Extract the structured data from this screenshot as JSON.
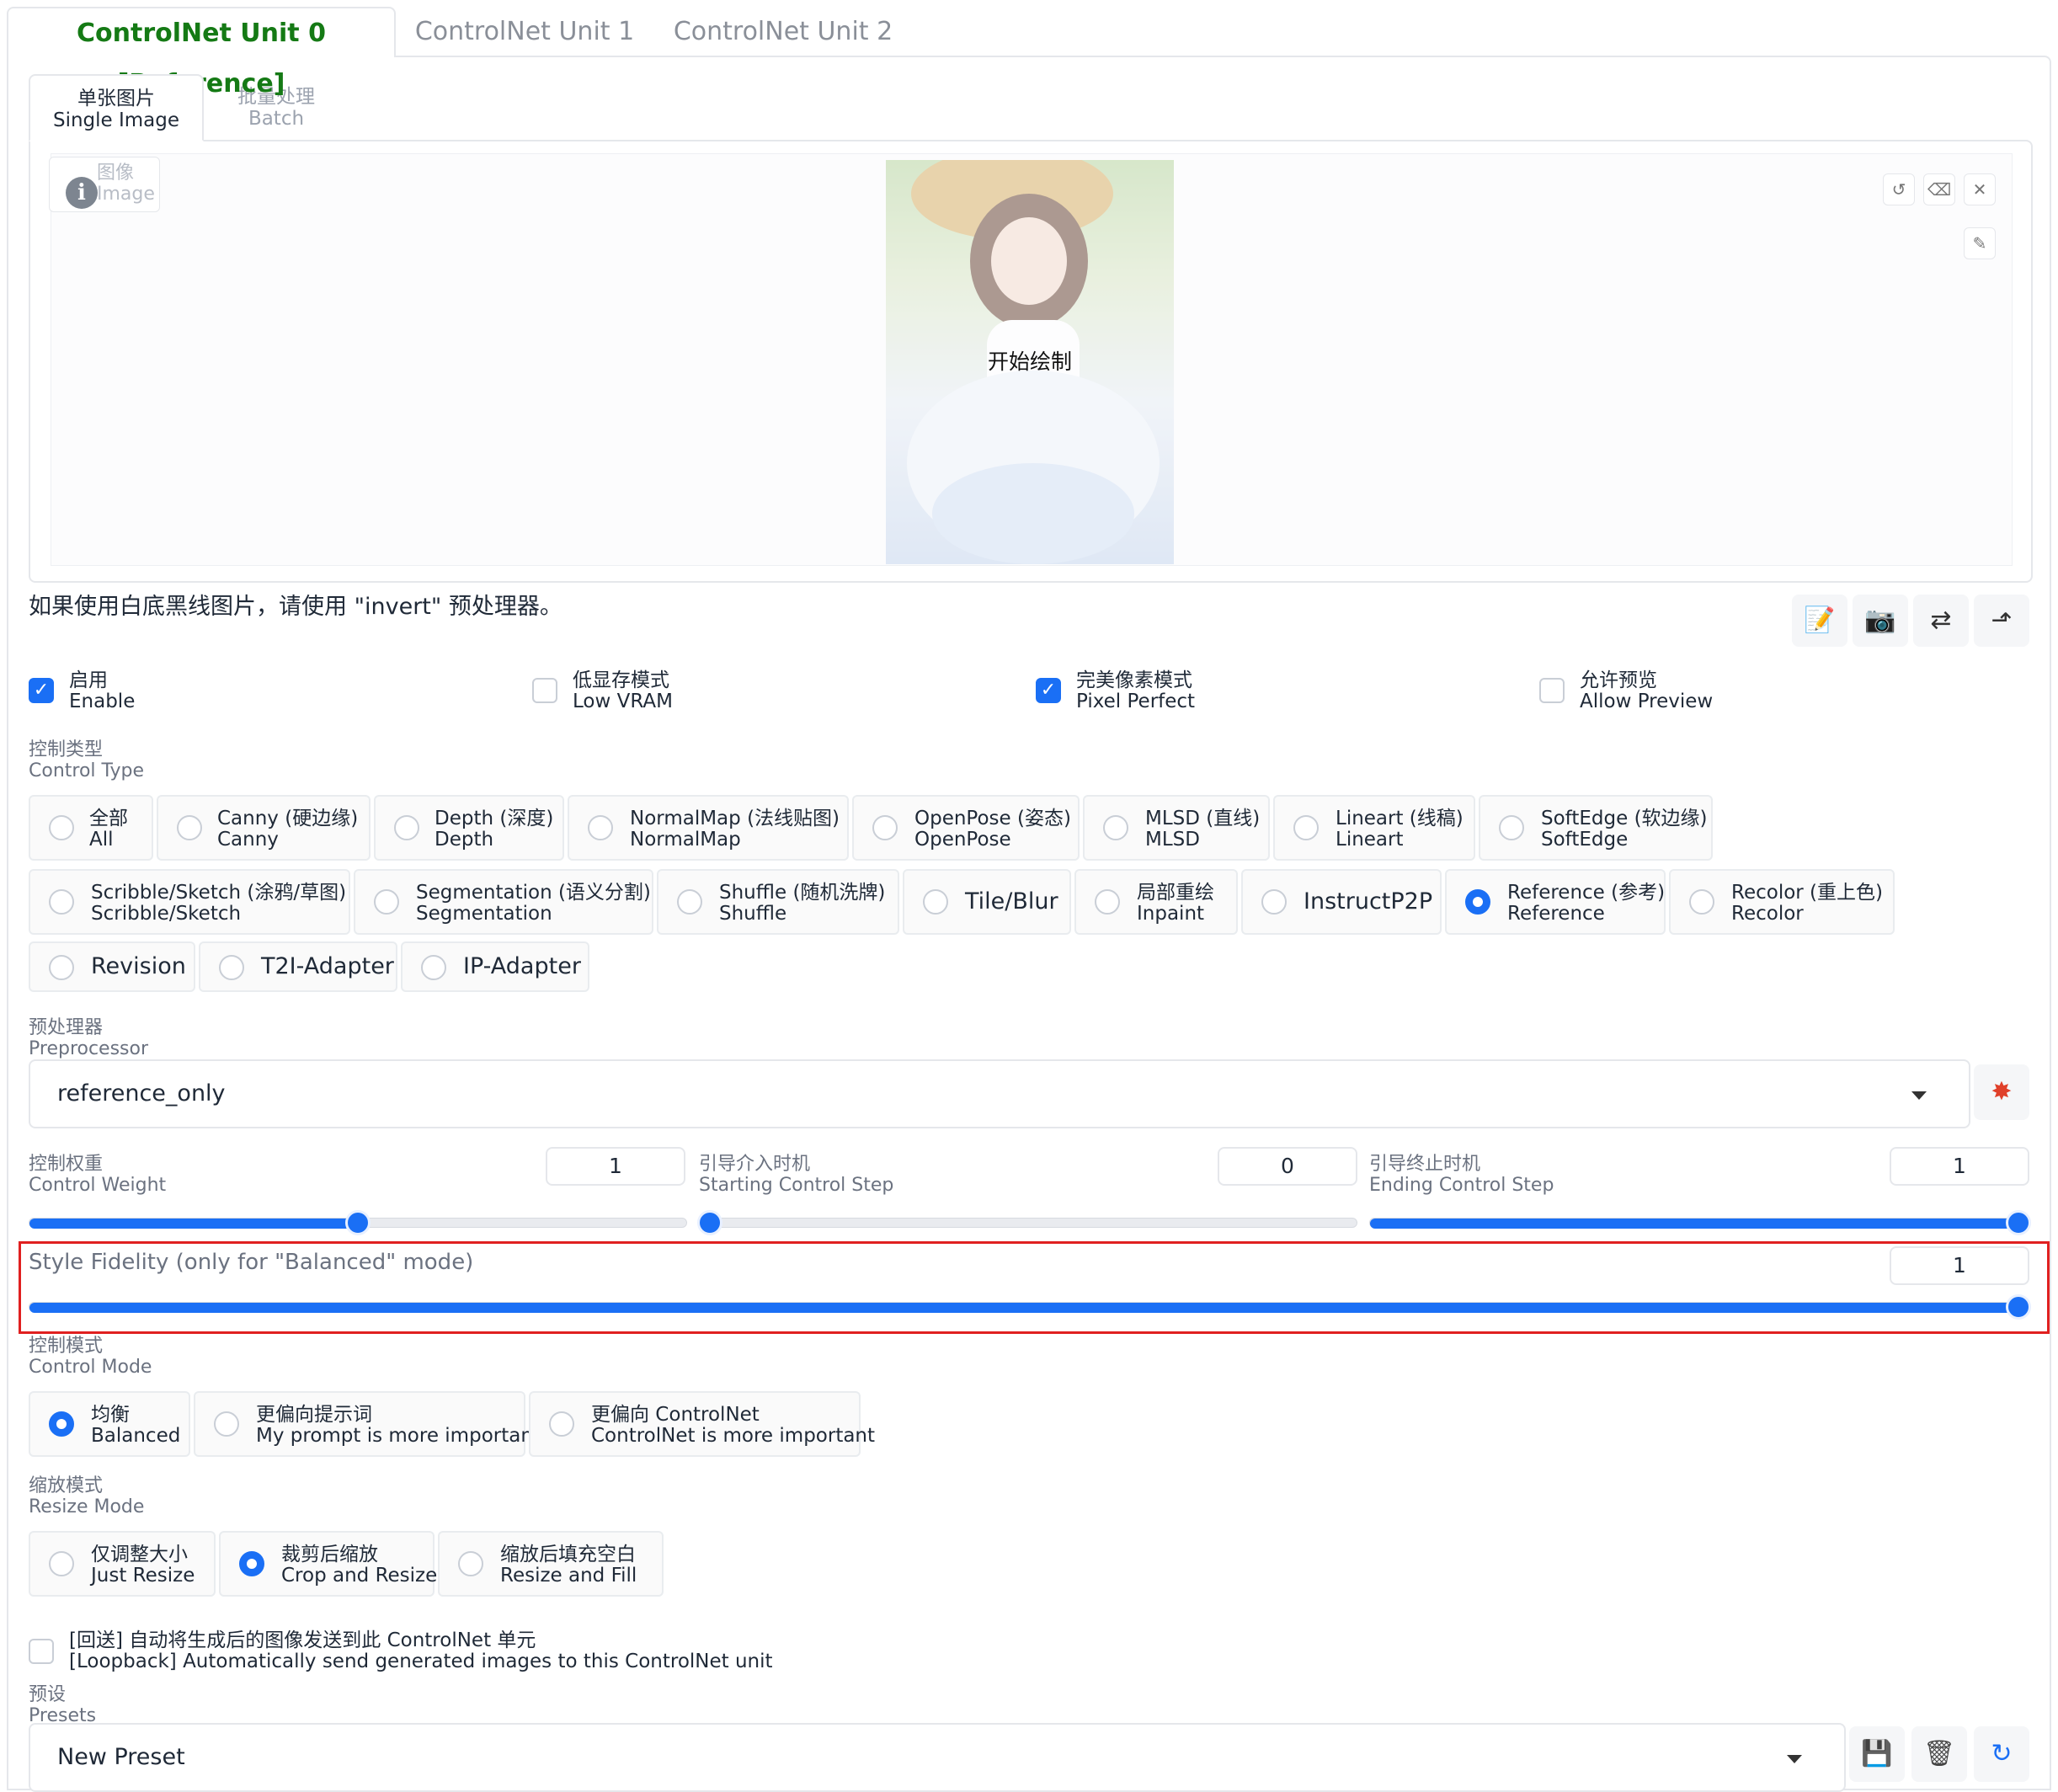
{
  "unit_tabs": [
    "ControlNet Unit 0 [Reference]",
    "ControlNet Unit 1",
    "ControlNet Unit 2"
  ],
  "sub_tabs": [
    {
      "zh": "单张图片",
      "en": "Single Image"
    },
    {
      "zh": "批量处理",
      "en": "Batch"
    }
  ],
  "image": {
    "label_zh": "图像",
    "label_en": "Image",
    "center_label": "开始绘制",
    "tools": [
      "undo-icon",
      "eraser-icon",
      "close-icon",
      "brush-icon"
    ]
  },
  "hint": "如果使用白底黑线图片，请使用 \"invert\" 预处理器。",
  "image_actions": [
    "edit-icon",
    "camera-icon",
    "swap-icon",
    "upload-arrow-icon"
  ],
  "options": [
    {
      "zh": "启用",
      "en": "Enable",
      "checked": true
    },
    {
      "zh": "低显存模式",
      "en": "Low VRAM",
      "checked": false
    },
    {
      "zh": "完美像素模式",
      "en": "Pixel Perfect",
      "checked": true
    },
    {
      "zh": "允许预览",
      "en": "Allow Preview",
      "checked": false
    }
  ],
  "control_type": {
    "label_zh": "控制类型",
    "label_en": "Control Type",
    "items": [
      {
        "line1": "全部",
        "line2": "All"
      },
      {
        "line1": "Canny (硬边缘)",
        "line2": "Canny"
      },
      {
        "line1": "Depth (深度)",
        "line2": "Depth"
      },
      {
        "line1": "NormalMap (法线贴图)",
        "line2": "NormalMap"
      },
      {
        "line1": "OpenPose (姿态)",
        "line2": "OpenPose"
      },
      {
        "line1": "MLSD (直线)",
        "line2": "MLSD"
      },
      {
        "line1": "Lineart (线稿)",
        "line2": "Lineart"
      },
      {
        "line1": "SoftEdge (软边缘)",
        "line2": "SoftEdge"
      },
      {
        "line1": "Scribble/Sketch (涂鸦/草图)",
        "line2": "Scribble/Sketch"
      },
      {
        "line1": "Segmentation (语义分割)",
        "line2": "Segmentation"
      },
      {
        "line1": "Shuffle (随机洗牌)",
        "line2": "Shuffle"
      },
      {
        "line1": "Tile/Blur",
        "line2": ""
      },
      {
        "line1": "局部重绘",
        "line2": "Inpaint"
      },
      {
        "line1": "InstructP2P",
        "line2": ""
      },
      {
        "line1": "Reference (参考)",
        "line2": "Reference"
      },
      {
        "line1": "Recolor (重上色)",
        "line2": "Recolor"
      },
      {
        "line1": "Revision",
        "line2": ""
      },
      {
        "line1": "T2I-Adapter",
        "line2": ""
      },
      {
        "line1": "IP-Adapter",
        "line2": ""
      }
    ],
    "selected": "Reference"
  },
  "preprocessor": {
    "label_zh": "预处理器",
    "label_en": "Preprocessor",
    "value": "reference_only",
    "run_icon": "explosion-icon"
  },
  "sliders": {
    "control_weight": {
      "label_zh": "控制权重",
      "label_en": "Control Weight",
      "value": "1",
      "fraction": 0.5
    },
    "starting_step": {
      "label_zh": "引导介入时机",
      "label_en": "Starting Control Step",
      "value": "0",
      "fraction": 0.0
    },
    "ending_step": {
      "label_zh": "引导终止时机",
      "label_en": "Ending Control Step",
      "value": "1",
      "fraction": 1.0
    },
    "style_fidelity": {
      "label": "Style Fidelity (only for \"Balanced\" mode)",
      "value": "1",
      "fraction": 1.0
    }
  },
  "control_mode": {
    "label_zh": "控制模式",
    "label_en": "Control Mode",
    "items": [
      {
        "zh": "均衡",
        "en": "Balanced"
      },
      {
        "zh": "更偏向提示词",
        "en": "My prompt is more important"
      },
      {
        "zh": "更偏向 ControlNet",
        "en": "ControlNet is more important"
      }
    ],
    "selected": "Balanced"
  },
  "resize_mode": {
    "label_zh": "缩放模式",
    "label_en": "Resize Mode",
    "items": [
      {
        "zh": "仅调整大小",
        "en": "Just Resize"
      },
      {
        "zh": "裁剪后缩放",
        "en": "Crop and Resize"
      },
      {
        "zh": "缩放后填充空白",
        "en": "Resize and Fill"
      }
    ],
    "selected": "Crop and Resize"
  },
  "loopback": {
    "zh": "[回送] 自动将生成后的图像发送到此 ControlNet 单元",
    "en": "[Loopback] Automatically send generated images to this ControlNet unit",
    "checked": false
  },
  "presets": {
    "label_zh": "预设",
    "label_en": "Presets",
    "value": "New Preset",
    "actions": [
      "save-icon",
      "trash-icon",
      "refresh-icon"
    ]
  },
  "colors": {
    "accent": "#1a6ff5",
    "active_tab": "#157a15",
    "highlight": "#e02020"
  }
}
